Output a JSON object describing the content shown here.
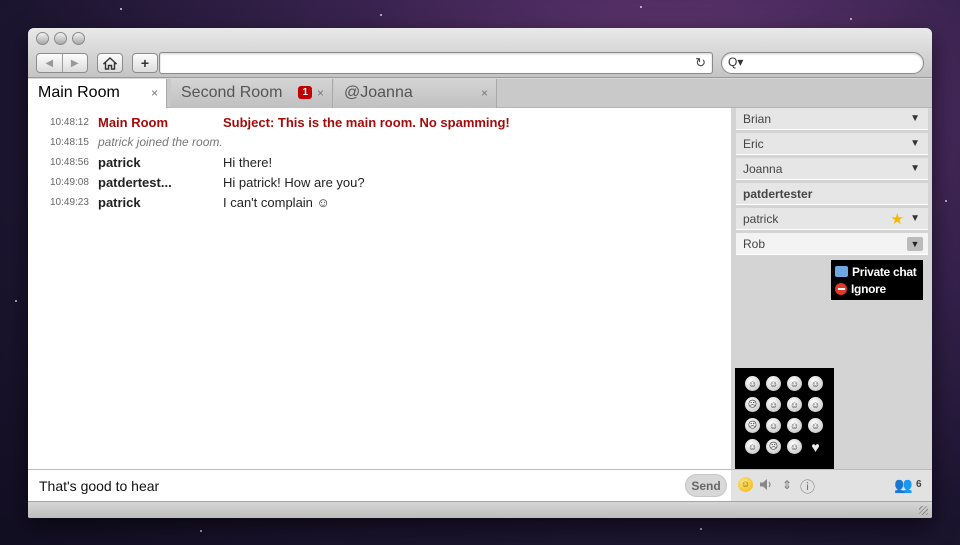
{
  "toolbar": {
    "back_icon": "back-arrow-icon",
    "forward_icon": "forward-arrow-icon",
    "home_icon": "home-icon",
    "add_label": "+",
    "reload_icon": "↻",
    "search_icon": "search-icon",
    "search_glyph": "Q▾",
    "url": "",
    "search_value": ""
  },
  "tabs": [
    {
      "label": "Main Room",
      "close": "×",
      "active": true
    },
    {
      "label": "Second Room",
      "close": "×",
      "badge": "1"
    },
    {
      "label": "@Joanna",
      "close": "×"
    }
  ],
  "messages": [
    {
      "time": "10:48:12",
      "nick": "Main Room",
      "text": "Subject: This is the main room. No spamming!",
      "type": "system"
    },
    {
      "time": "10:48:15",
      "nick": "patrick joined the room.",
      "text": "",
      "type": "join"
    },
    {
      "time": "10:48:56",
      "nick": "patrick",
      "text": "Hi there!",
      "type": "normal"
    },
    {
      "time": "10:49:08",
      "nick": "patdertest...",
      "text": "Hi patrick! How are you?",
      "type": "normal"
    },
    {
      "time": "10:49:23",
      "nick": "patrick",
      "text": "I can't complain ☺",
      "type": "normal"
    }
  ],
  "roster": [
    {
      "name": "Brian",
      "arrow": "▼"
    },
    {
      "name": "Eric",
      "arrow": "▼"
    },
    {
      "name": "Joanna",
      "arrow": "▼"
    },
    {
      "name": "patdertester",
      "self": true
    },
    {
      "name": "patrick",
      "arrow": "▼",
      "star": "★"
    },
    {
      "name": "Rob",
      "arrow": "▼",
      "open": true
    }
  ],
  "context_menu": {
    "private_chat": "Private chat",
    "ignore": "Ignore"
  },
  "emoticons": [
    "☺",
    "☺",
    "☺",
    "☺",
    "☹",
    "☺",
    "☺",
    "☺",
    "☹",
    "☺",
    "☺",
    "☺",
    "☺",
    "☹",
    "☺",
    "♥"
  ],
  "input": {
    "value": "That's good to hear",
    "send_label": "Send"
  },
  "controls": {
    "smiley": "☺",
    "sound": "🔊",
    "stepper": "⇕",
    "info": "ⓘ",
    "users_icon": "👥",
    "user_count": "6"
  },
  "colors": {
    "system_red": "#a30b0b",
    "badge_red": "#c00000"
  }
}
